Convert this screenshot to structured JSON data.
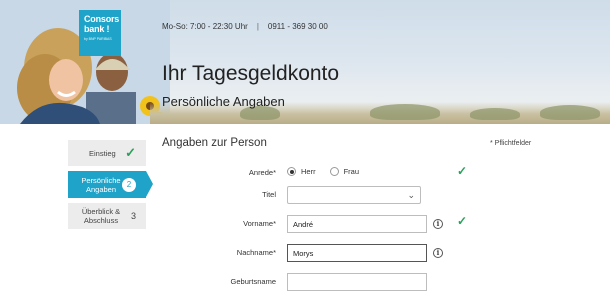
{
  "brand": {
    "logo_line1": "Consors",
    "logo_line2": "bank !",
    "logo_sub": "by BNP PARIBAS",
    "color": "#1fa3c9"
  },
  "header": {
    "hours": "Mo-So: 7:00 - 22:30 Uhr",
    "separator": "|",
    "phone": "0911 - 369 30 00",
    "title": "Ihr Tagesgeldkonto",
    "subtitle": "Persönliche Angaben"
  },
  "steps": [
    {
      "label": "Einstieg",
      "status": "done",
      "mark": "✓"
    },
    {
      "label": "Persönliche Angaben",
      "status": "active",
      "mark": "2"
    },
    {
      "label": "Überblick & Abschluss",
      "status": "todo",
      "mark": "3"
    }
  ],
  "form": {
    "section_title": "Angaben zur Person",
    "required_note": "* Pflichtfelder",
    "anrede": {
      "label": "Anrede*",
      "options": [
        "Herr",
        "Frau"
      ],
      "selected": "Herr"
    },
    "titel": {
      "label": "Titel",
      "value": ""
    },
    "vorname": {
      "label": "Vorname*",
      "value": "André"
    },
    "nachname": {
      "label": "Nachname*",
      "value": "Morys"
    },
    "geburtsname": {
      "label": "Geburtsname",
      "value": ""
    }
  },
  "colors": {
    "accent": "#1fa3c9",
    "success": "#2aa15a"
  }
}
